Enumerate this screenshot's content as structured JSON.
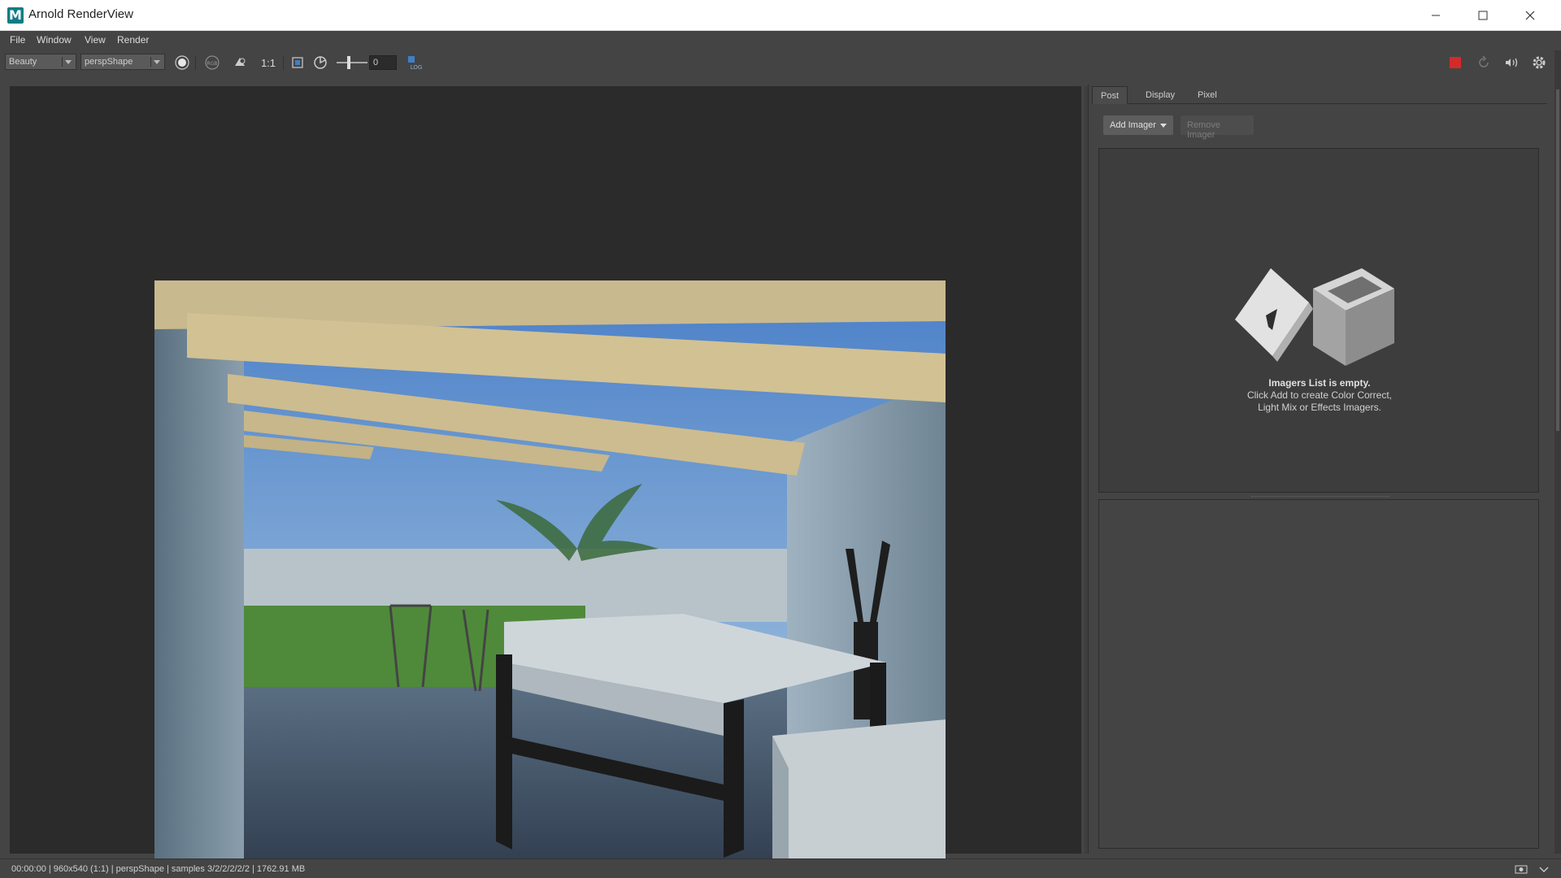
{
  "window": {
    "title": "Arnold RenderView",
    "app_logo_letter": "M"
  },
  "menu": [
    "File",
    "Window",
    "View",
    "Render"
  ],
  "toolbar": {
    "aov": "Beauty",
    "camera": "perspShape",
    "zoom_label": "1:1",
    "exposure_value": "0",
    "log_label": "LOG",
    "icons": [
      "display-mode-icon",
      "rgb-channels-icon",
      "snapshot-icon",
      "region-render-icon",
      "exposure-icon",
      "log-view-icon",
      "stop-render-icon",
      "refresh-render-icon",
      "ipr-icon",
      "settings-icon"
    ],
    "stop_color": "#d42a2a"
  },
  "panel": {
    "tabs": [
      "Post",
      "Display",
      "Pixel"
    ],
    "active_tab": "Post",
    "add_imager": "Add Imager",
    "remove_imager": "Remove Imager",
    "empty_title": "Imagers List is empty.",
    "empty_line1": "Click Add to create Color Correct,",
    "empty_line2": "Light Mix or Effects Imagers."
  },
  "status": {
    "text": "00:00:00 | 960x540 (1:1) | perspShape  | samples 3/2/2/2/2/2 | 1762.91 MB"
  }
}
